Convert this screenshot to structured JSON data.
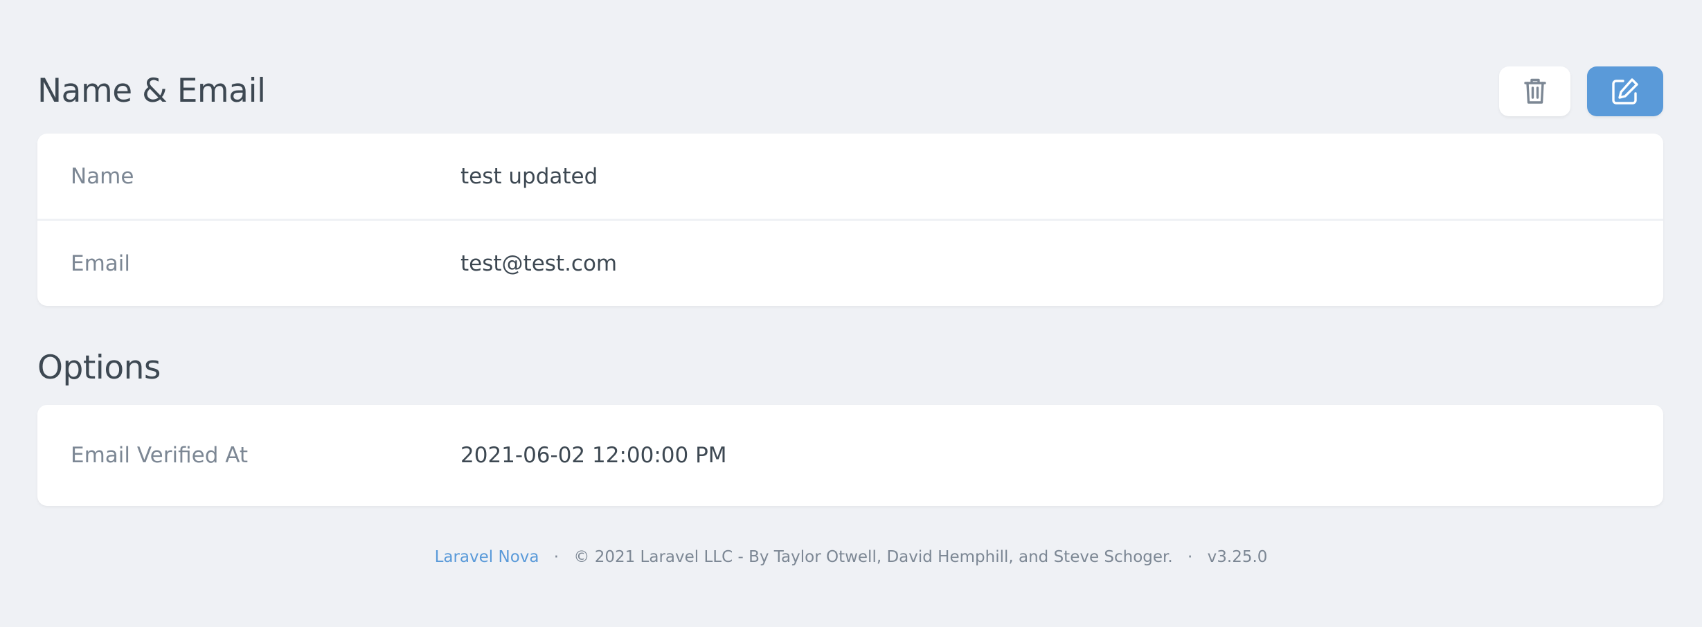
{
  "sections": {
    "name_email": {
      "title": "Name & Email",
      "fields": [
        {
          "label": "Name",
          "value": "test updated"
        },
        {
          "label": "Email",
          "value": "test@test.com"
        }
      ]
    },
    "options": {
      "title": "Options",
      "fields": [
        {
          "label": "Email Verified At",
          "value": "2021-06-02 12:00:00 PM"
        }
      ]
    }
  },
  "actions": {
    "delete_icon": "trash-icon",
    "edit_icon": "edit-icon"
  },
  "footer": {
    "brand_link": "Laravel Nova",
    "separator": "·",
    "copyright": "© 2021 Laravel LLC - By Taylor Otwell, David Hemphill, and Steve Schoger.",
    "version": "v3.25.0"
  },
  "colors": {
    "background": "#eff1f5",
    "accent": "#5a9ad9",
    "label": "#7c8794",
    "text": "#3d4852"
  }
}
